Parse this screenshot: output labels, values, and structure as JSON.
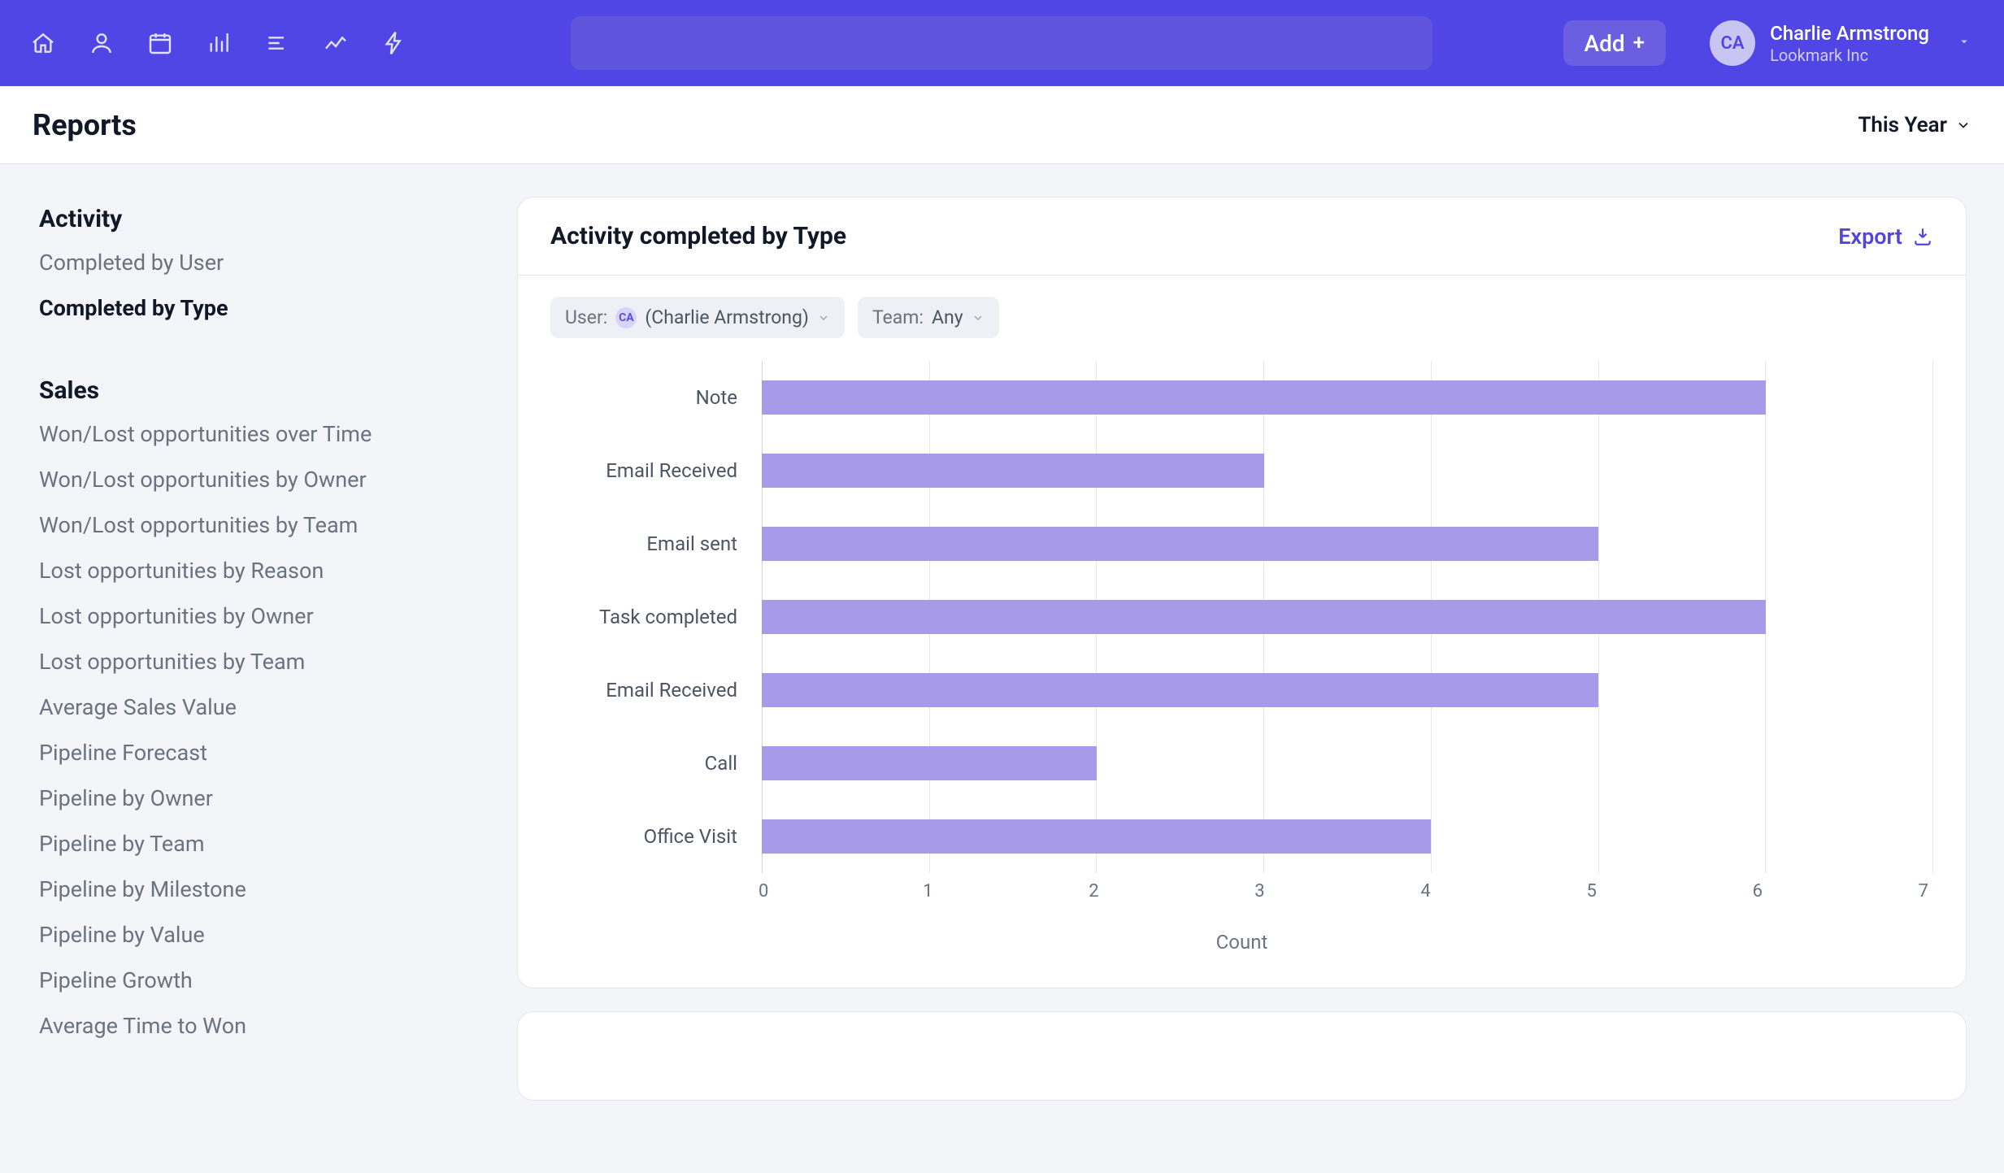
{
  "colors": {
    "brand": "#4F46E5",
    "bar": "#A79AE8"
  },
  "topnav": {
    "add_label": "Add",
    "search_placeholder": ""
  },
  "user": {
    "initials": "CA",
    "name": "Charlie Armstrong",
    "org": "Lookmark Inc"
  },
  "page": {
    "title": "Reports",
    "range_label": "This Year"
  },
  "sidebar": {
    "groups": [
      {
        "heading": "Activity",
        "items": [
          {
            "label": "Completed by User",
            "active": false
          },
          {
            "label": "Completed by Type",
            "active": true
          }
        ]
      },
      {
        "heading": "Sales",
        "items": [
          {
            "label": "Won/Lost opportunities over Time"
          },
          {
            "label": "Won/Lost opportunities by Owner"
          },
          {
            "label": "Won/Lost opportunities by Team"
          },
          {
            "label": "Lost opportunities by Reason"
          },
          {
            "label": "Lost opportunities by Owner"
          },
          {
            "label": "Lost opportunities by Team"
          },
          {
            "label": "Average Sales Value"
          },
          {
            "label": "Pipeline Forecast"
          },
          {
            "label": "Pipeline by Owner"
          },
          {
            "label": "Pipeline by Team"
          },
          {
            "label": "Pipeline by Milestone"
          },
          {
            "label": "Pipeline by Value"
          },
          {
            "label": "Pipeline Growth"
          },
          {
            "label": "Average Time to Won"
          }
        ]
      }
    ]
  },
  "card": {
    "title": "Activity completed by Type",
    "export_label": "Export"
  },
  "filters": {
    "user_label": "User:",
    "user_initials": "CA",
    "user_value": "(Charlie Armstrong)",
    "team_label": "Team:",
    "team_value": "Any"
  },
  "chart_data": {
    "type": "bar",
    "orientation": "horizontal",
    "title": "Activity completed by Type",
    "xlabel": "Count",
    "ylabel": "",
    "xlim": [
      0,
      7
    ],
    "x_ticks": [
      "0",
      "1",
      "2",
      "3",
      "4",
      "5",
      "6",
      "7"
    ],
    "categories": [
      "Note",
      "Email Received",
      "Email sent",
      "Task completed",
      "Email Received",
      "Call",
      "Office Visit"
    ],
    "values": [
      6,
      3,
      5,
      6,
      5,
      2,
      4
    ]
  }
}
